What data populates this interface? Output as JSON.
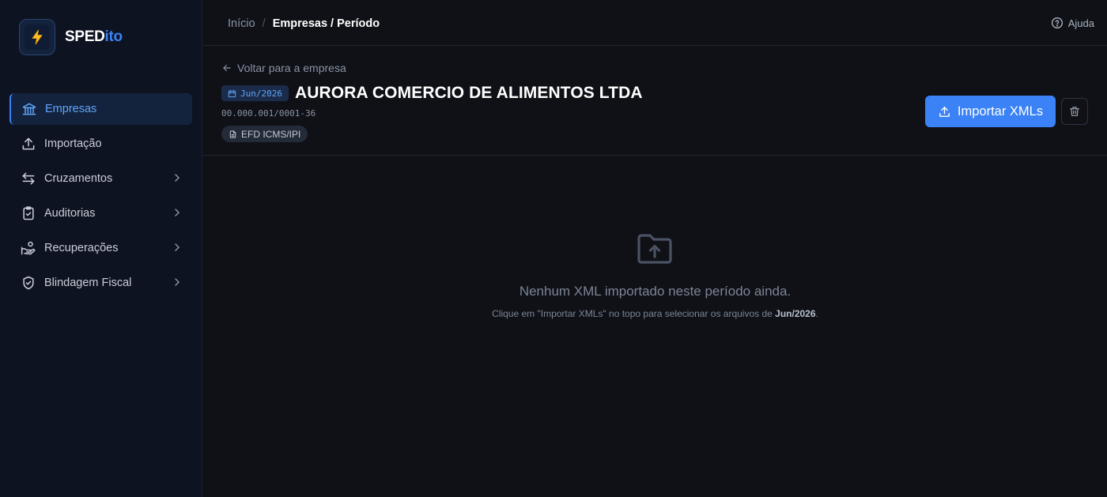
{
  "app": {
    "brand_main": "SPED",
    "brand_accent": "ito",
    "accent_color": "#3b82f6"
  },
  "sidebar": {
    "items": [
      {
        "label": "Empresas",
        "icon": "bank-icon",
        "active": true,
        "has_submenu": false
      },
      {
        "label": "Importação",
        "icon": "upload-icon",
        "active": false,
        "has_submenu": false
      },
      {
        "label": "Cruzamentos",
        "icon": "arrows-swap-icon",
        "active": false,
        "has_submenu": true
      },
      {
        "label": "Auditorias",
        "icon": "clipboard-check-icon",
        "active": false,
        "has_submenu": true
      },
      {
        "label": "Recuperações",
        "icon": "hand-coins-icon",
        "active": false,
        "has_submenu": true
      },
      {
        "label": "Blindagem Fiscal",
        "icon": "shield-check-icon",
        "active": false,
        "has_submenu": true
      }
    ]
  },
  "topbar": {
    "breadcrumb_home": "Início",
    "breadcrumb_sep": "/",
    "breadcrumb_current": "Empresas / Período",
    "help_label": "Ajuda"
  },
  "header": {
    "back_label": "Voltar para a empresa",
    "period": "Jun/2026",
    "company_name": "AURORA COMERCIO DE ALIMENTOS LTDA",
    "cnpj": "00.000.001/0001-36",
    "doc_type": "EFD ICMS/IPI",
    "import_label": "Importar XMLs"
  },
  "empty_state": {
    "title": "Nenhum XML importado neste período ainda.",
    "subtitle_prefix": "Clique em \"Importar XMLs\" no topo para selecionar os arquivos de ",
    "subtitle_period": "Jun/2026",
    "subtitle_suffix": "."
  }
}
